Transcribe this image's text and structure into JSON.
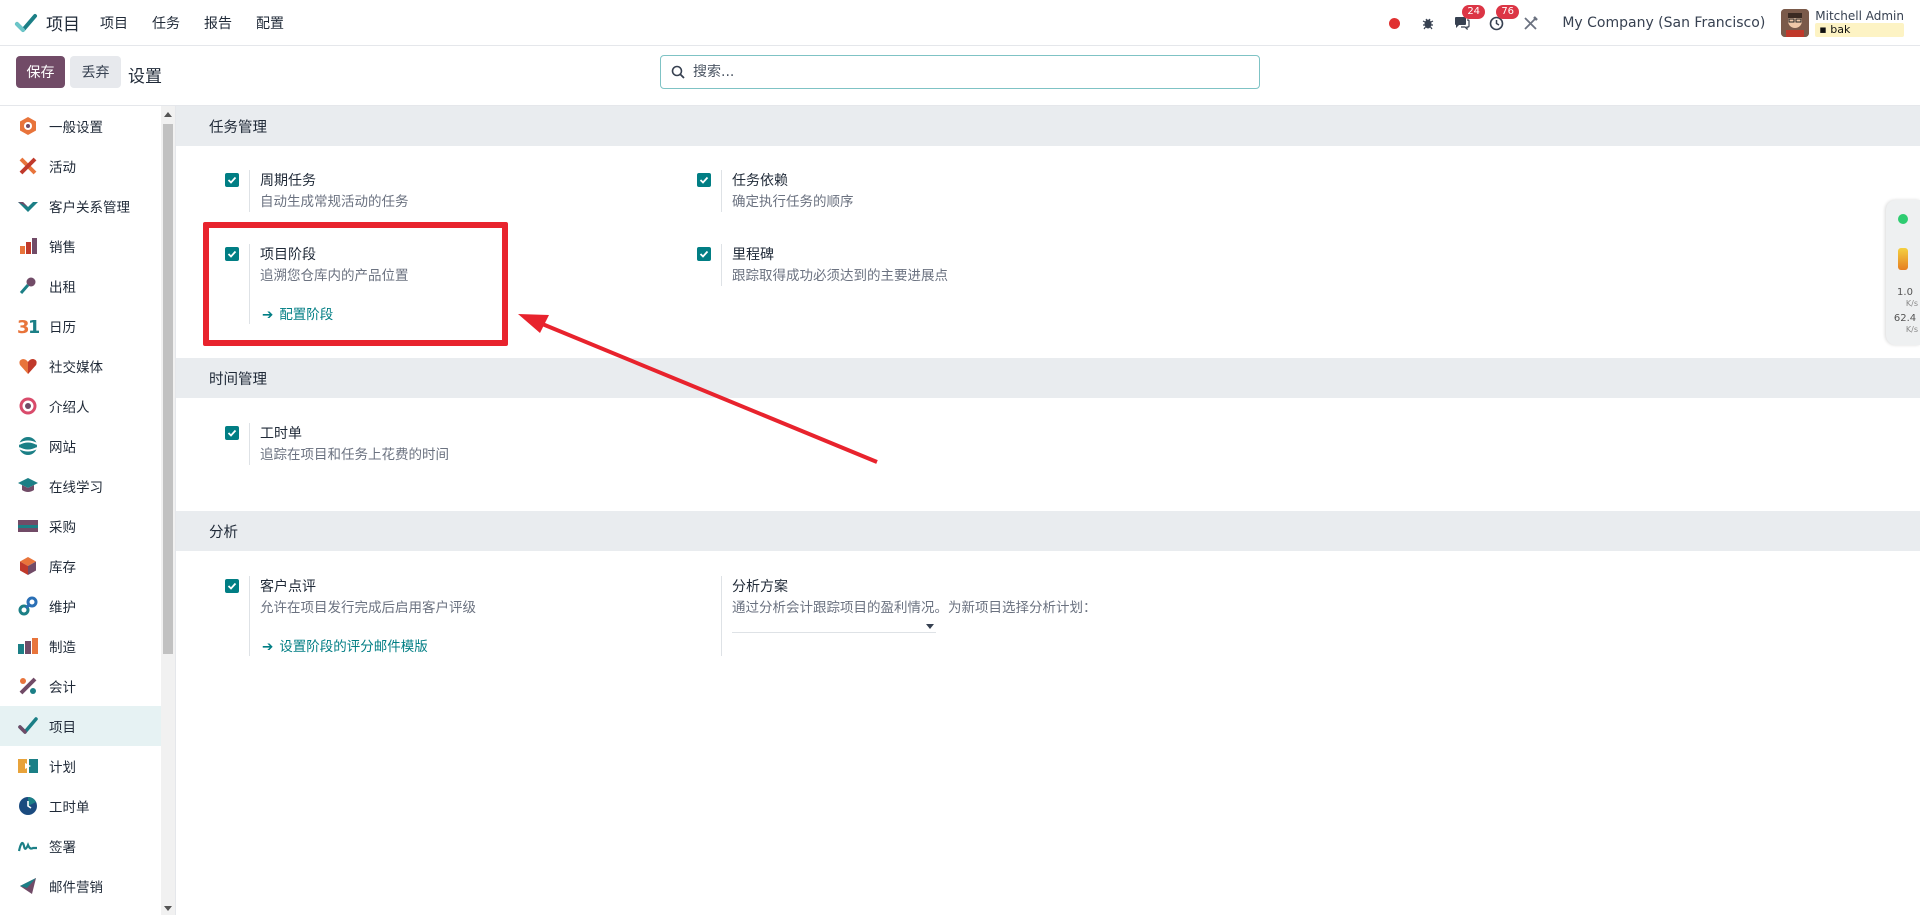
{
  "nav": {
    "app_name": "项目",
    "menu": [
      "项目",
      "任务",
      "报告",
      "配置"
    ],
    "messages_badge": "24",
    "activity_badge": "76",
    "company": "My Company (San Francisco)",
    "user_name": "Mitchell Admin",
    "db_name": "bak"
  },
  "control": {
    "save_label": "保存",
    "discard_label": "丢弃",
    "title": "设置",
    "search_placeholder": "搜索..."
  },
  "sidebar": {
    "items": [
      {
        "label": "一般设置",
        "icon": "settings-icon"
      },
      {
        "label": "活动",
        "icon": "activity-icon"
      },
      {
        "label": "客户关系管理",
        "icon": "crm-icon"
      },
      {
        "label": "销售",
        "icon": "sales-icon"
      },
      {
        "label": "出租",
        "icon": "rental-icon"
      },
      {
        "label": "日历",
        "icon": "calendar-icon"
      },
      {
        "label": "社交媒体",
        "icon": "social-icon"
      },
      {
        "label": "介绍人",
        "icon": "referral-icon"
      },
      {
        "label": "网站",
        "icon": "website-icon"
      },
      {
        "label": "在线学习",
        "icon": "elearning-icon"
      },
      {
        "label": "采购",
        "icon": "purchase-icon"
      },
      {
        "label": "库存",
        "icon": "inventory-icon"
      },
      {
        "label": "维护",
        "icon": "maintenance-icon"
      },
      {
        "label": "制造",
        "icon": "manufacturing-icon"
      },
      {
        "label": "会计",
        "icon": "accounting-icon"
      },
      {
        "label": "项目",
        "icon": "project-icon"
      },
      {
        "label": "计划",
        "icon": "planning-icon"
      },
      {
        "label": "工时单",
        "icon": "timesheet-icon"
      },
      {
        "label": "签署",
        "icon": "sign-icon"
      },
      {
        "label": "邮件营销",
        "icon": "email-marketing-icon"
      }
    ]
  },
  "sections": {
    "task_mgmt": {
      "title": "任务管理",
      "recurring": {
        "title": "周期任务",
        "desc": "自动生成常规活动的任务",
        "checked": true
      },
      "dependencies": {
        "title": "任务依赖",
        "desc": "确定执行任务的顺序",
        "checked": true
      },
      "stages": {
        "title": "项目阶段",
        "desc": "追溯您仓库内的产品位置",
        "link": "配置阶段",
        "checked": true
      },
      "milestones": {
        "title": "里程碑",
        "desc": "跟踪取得成功必须达到的主要进展点",
        "checked": true
      }
    },
    "time_mgmt": {
      "title": "时间管理",
      "timesheets": {
        "title": "工时单",
        "desc": "追踪在项目和任务上花费的时间",
        "checked": true
      }
    },
    "analytics": {
      "title": "分析",
      "rating": {
        "title": "客户点评",
        "desc": "允许在项目发行完成后启用客户评级",
        "link": "设置阶段的评分邮件模版",
        "checked": true
      },
      "plan": {
        "title": "分析方案",
        "desc": "通过分析会计跟踪项目的盈利情况。为新项目选择分析计划：",
        "value": ""
      }
    }
  },
  "widget": {
    "up_value": "1.0",
    "up_unit": "K/s",
    "down_value": "62.4",
    "down_unit": "K/s"
  },
  "colors": {
    "brand": "#714b67",
    "accent": "#017e84",
    "annotation": "#e8232d"
  }
}
